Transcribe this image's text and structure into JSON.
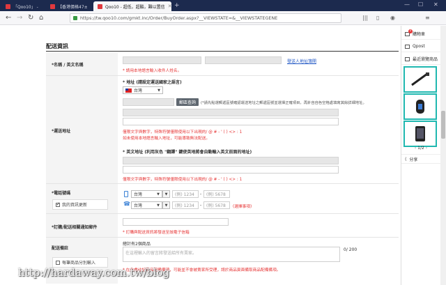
{
  "browser": {
    "tabs": [
      {
        "title": "「Qoo10」 - ",
        "active": false
      },
      {
        "title": "【香港價格47±",
        "active": false
      },
      {
        "title": "Qoo10 - 超低，超酷，難以置信",
        "active": true
      }
    ],
    "url": "https://tw.qoo10.com/gmkt.inc/Order/BuyOrder.aspx?__VIEWSTATE=&__VIEWSTATEGENE"
  },
  "section_title": "配送資訊",
  "name_row": {
    "label": "*名稱 / 英文名稱",
    "hint": "* 請用本地語言輸入收件人姓名。",
    "address_book_link": "發送人地址簿開"
  },
  "address_row": {
    "label": "*運送地址",
    "local_heading": "* 地址 (請設定運送國家之語言)",
    "country": "台灣",
    "search_button": "郵區查詢",
    "search_note": "(*請先點選郵遞區號確認運送地址之郵遞區號並選擇正確項目，再針自自色空格處填寫其餘詳細地址。",
    "rule_note": "僅限文字與數字，特殊符號僅限使用以下出現的/ @ # - ' ( ) <> : 1",
    "warn_note": "如未使用本地語言輸入地址，可能導致無法配送。",
    "english_heading": "* 英文地址 (利用灰色 \"翻譯\" 鍵使英地將會自動輸入英文前面的地址)",
    "english_rule": "僅限文字與數字，特殊符號僅限使用以下出現的/ @ # - ' ( ) <> : 1"
  },
  "phone_row": {
    "label": "*電話號碼",
    "checkbox_label": "我的資訊更新",
    "mobile_country": "台灣",
    "mobile_ph1": "(例) 1234",
    "mobile_ph2": "(例) 5678",
    "tel_country": "台灣",
    "tel_ph1": "(例) 1234",
    "tel_ph2": "(例) 5678",
    "optional": "(選擇事項)"
  },
  "email_row": {
    "label": "*訂購/配送相關通知郵件",
    "hint": "* 訂購與配送資訊將發送至該電子信箱"
  },
  "remark_row": {
    "label": "配送備註",
    "checkbox_label": "每筆商品分別輸入",
    "count_text": "總計有2個商品",
    "placeholder": "在這裡輸入的留言將發送給所有賣家。",
    "counter": "0/ 200",
    "warning": "* 在此處註記商品配備備項，可能並不會被賣家所受理，請於商品頁面備取商品配備備項。"
  },
  "sidebar": {
    "cart_label": "購物車",
    "cart_count": "2",
    "qpost_label": "Qpost",
    "recent_label": "最近瀏覽商品",
    "pager": "1/2",
    "share_label": "分享"
  },
  "watermark": "http://hardaway.com.tw/blog",
  "colors": {
    "accent_red": "#e63535",
    "link_blue": "#1f56c4",
    "tab_bar": "#1c2a4e",
    "sidebar_highlight": "#1fb8b0"
  }
}
